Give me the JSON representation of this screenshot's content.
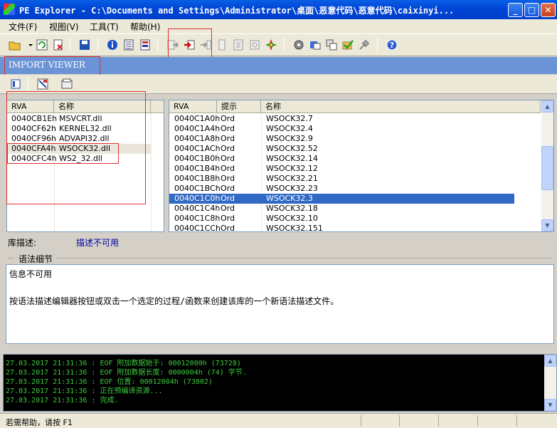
{
  "window": {
    "title": "PE Explorer - C:\\Documents and Settings\\Administrator\\桌面\\恶意代码\\恶意代码\\caixinyi..."
  },
  "menu": [
    {
      "label": "文件(F)"
    },
    {
      "label": "视图(V)"
    },
    {
      "label": "工具(T)"
    },
    {
      "label": "帮助(H)"
    }
  ],
  "viewer": {
    "title": "IMPORT VIEWER"
  },
  "libraries": {
    "columns": [
      "RVA",
      "名称"
    ],
    "rows": [
      {
        "rva": "0040CB1Eh",
        "name": "MSVCRT.dll"
      },
      {
        "rva": "0040CF62h",
        "name": "KERNEL32.dll"
      },
      {
        "rva": "0040CF96h",
        "name": "ADVAPI32.dll"
      },
      {
        "rva": "0040CFA4h",
        "name": "WSOCK32.dll"
      },
      {
        "rva": "0040CFC4h",
        "name": "WS2_32.dll"
      }
    ]
  },
  "functions": {
    "columns": [
      "RVA",
      "提示",
      "名称"
    ],
    "rows": [
      {
        "rva": "0040C1A0h",
        "hint": "Ord",
        "name": "WSOCK32.7"
      },
      {
        "rva": "0040C1A4h",
        "hint": "Ord",
        "name": "WSOCK32.4"
      },
      {
        "rva": "0040C1A8h",
        "hint": "Ord",
        "name": "WSOCK32.9"
      },
      {
        "rva": "0040C1ACh",
        "hint": "Ord",
        "name": "WSOCK32.52"
      },
      {
        "rva": "0040C1B0h",
        "hint": "Ord",
        "name": "WSOCK32.14"
      },
      {
        "rva": "0040C1B4h",
        "hint": "Ord",
        "name": "WSOCK32.12"
      },
      {
        "rva": "0040C1B8h",
        "hint": "Ord",
        "name": "WSOCK32.21"
      },
      {
        "rva": "0040C1BCh",
        "hint": "Ord",
        "name": "WSOCK32.23"
      },
      {
        "rva": "0040C1C0h",
        "hint": "Ord",
        "name": "WSOCK32.3"
      },
      {
        "rva": "0040C1C4h",
        "hint": "Ord",
        "name": "WSOCK32.18"
      },
      {
        "rva": "0040C1C8h",
        "hint": "Ord",
        "name": "WSOCK32.10"
      },
      {
        "rva": "0040C1CCh",
        "hint": "Ord",
        "name": "WSOCK32.151"
      }
    ]
  },
  "library_description": {
    "label": "库描述:",
    "value": "描述不可用"
  },
  "syntax_details": {
    "label": "语法细节",
    "line1": "信息不可用",
    "line2": "按语法描述编辑器按钮或双击一个选定的过程/函数来创建该库的一个新语法描述文件。"
  },
  "log": [
    "27.03.2017 21:31:36 : EOF 附加数据始于: 00012000h  (73728)",
    "27.03.2017 21:31:36 : EOF 附加数据长度: 0000004h  (74) 字节.",
    "27.03.2017 21:31:36 : EOF 位置: 00012004h  (73802)",
    "27.03.2017 21:31:36 : 正在预编译资源...",
    "27.03.2017 21:31:36 : 完成."
  ],
  "status": {
    "text": "若需帮助，请按 F1"
  },
  "colors": {
    "viewer_header": "#6b94d6",
    "selection": "#316ac5",
    "log_text": "#3ccc3c",
    "highlight_box": "#e03030"
  }
}
